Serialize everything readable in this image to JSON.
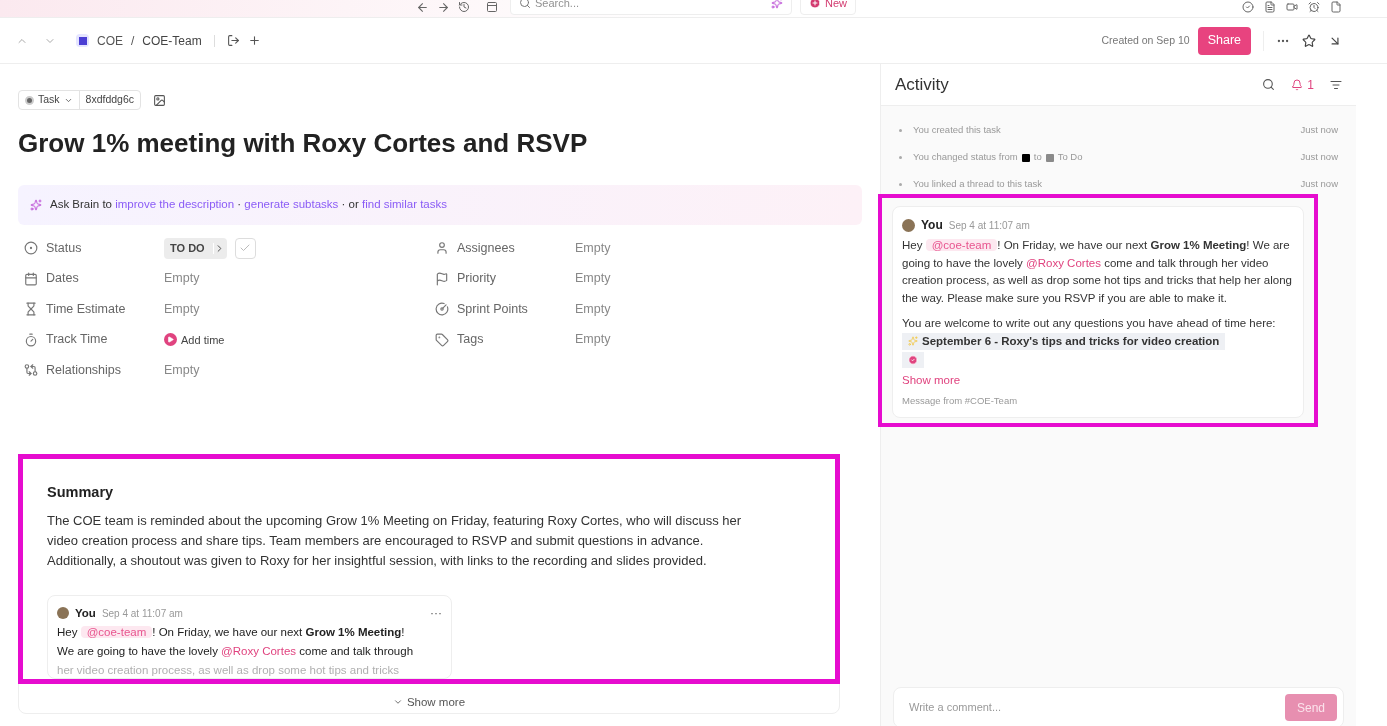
{
  "top_bar": {
    "search_placeholder": "Search...",
    "new_button": "New"
  },
  "breadcrumb": {
    "items": [
      "COE",
      "COE-Team"
    ],
    "separator": "/"
  },
  "header": {
    "created": "Created on Sep 10",
    "share": "Share"
  },
  "task": {
    "type": "Task",
    "id": "8xdfddg6c",
    "title": "Grow 1% meeting with Roxy Cortes and RSVP"
  },
  "brain": [
    {
      "kind": "text",
      "text": "Ask Brain to"
    },
    {
      "kind": "link",
      "text": "improve the description"
    },
    {
      "kind": "text",
      "text": "·"
    },
    {
      "kind": "link",
      "text": "generate subtasks"
    },
    {
      "kind": "text",
      "text": "· or"
    },
    {
      "kind": "link",
      "text": "find similar tasks"
    }
  ],
  "fields_left": [
    {
      "kind": "status",
      "label": "Status",
      "value": "TO DO",
      "checked": false
    },
    {
      "kind": "plain",
      "label": "Dates",
      "value": "Empty"
    },
    {
      "kind": "plain",
      "label": "Time Estimate",
      "value": "Empty"
    },
    {
      "kind": "timer",
      "label": "Track Time",
      "value": "Add time"
    },
    {
      "kind": "plain",
      "label": "Relationships",
      "value": "Empty"
    }
  ],
  "fields_right": [
    {
      "kind": "plain",
      "label": "Assignees",
      "value": "Empty"
    },
    {
      "kind": "plain",
      "label": "Priority",
      "value": "Empty"
    },
    {
      "kind": "plain",
      "label": "Sprint Points",
      "value": "Empty"
    },
    {
      "kind": "plain",
      "label": "Tags",
      "value": "Empty"
    }
  ],
  "summary": {
    "title": "Summary",
    "text": "The COE team is reminded about the upcoming Grow 1% Meeting on Friday, featuring Roxy Cortes, who will discuss her video creation process and share tips. Team members are encouraged to RSVP and submit questions in advance. Additionally, a shoutout was given to Roxy for her insightful session, with links to the recording and slides provided.",
    "preview": {
      "author": "You",
      "time": "Sep 4 at 11:07 am",
      "more": "···",
      "lines": [
        [
          {
            "kind": "text",
            "text": "Hey"
          },
          {
            "kind": "tag",
            "text": "@coe-team"
          },
          {
            "kind": "text",
            "text": "! On Friday, we have our next"
          },
          {
            "kind": "bold",
            "text": "Grow 1% Meeting"
          },
          {
            "kind": "text",
            "text": "!"
          }
        ],
        [
          {
            "kind": "text",
            "text": "We are going to have the lovely"
          },
          {
            "kind": "mention",
            "text": "@Roxy Cortes"
          },
          {
            "kind": "text",
            "text": "come and talk through"
          }
        ],
        [
          {
            "kind": "faded",
            "text": "her video creation process, as well as drop some hot tips and tricks"
          }
        ]
      ]
    },
    "show_more": "Show more"
  },
  "activity": {
    "title": "Activity",
    "notifications": "1",
    "events": [
      {
        "parts": [
          {
            "kind": "text",
            "text": "You created this task"
          }
        ],
        "time": "Just now"
      },
      {
        "parts": [
          {
            "kind": "text",
            "text": "You changed status from"
          },
          {
            "kind": "swatch",
            "color": "#000000"
          },
          {
            "kind": "text",
            "text": "to"
          },
          {
            "kind": "swatch",
            "color": "#8a8a8a"
          },
          {
            "kind": "text",
            "text": "To Do"
          }
        ],
        "time": "Just now"
      },
      {
        "parts": [
          {
            "kind": "text",
            "text": "You linked a thread to this task"
          }
        ],
        "time": "Just now"
      }
    ],
    "comment": {
      "author": "You",
      "time": "Sep 4 at 11:07 am",
      "paragraph1": [
        {
          "kind": "text",
          "text": "Hey"
        },
        {
          "kind": "tag",
          "text": "@coe-team"
        },
        {
          "kind": "text",
          "text": "! On Friday, we have our next"
        },
        {
          "kind": "bold",
          "text": "Grow 1% Meeting"
        },
        {
          "kind": "text",
          "text": "! We are going to have the lovely"
        },
        {
          "kind": "mention",
          "text": "@Roxy Cortes"
        },
        {
          "kind": "text",
          "text": "come and talk through her video creation process, as well as drop some hot tips and tricks that help her along the way. Please make sure you RSVP if you are able to make it."
        }
      ],
      "paragraph2": "You are welcome to write out any questions you have ahead of time here:",
      "chip": "September 6 - Roxy's tips and tricks for video creation",
      "show_more": "Show more",
      "source": "Message from #COE-Team"
    },
    "input": {
      "placeholder": "Write a comment...",
      "send": "Send",
      "send_disabled": true
    }
  }
}
